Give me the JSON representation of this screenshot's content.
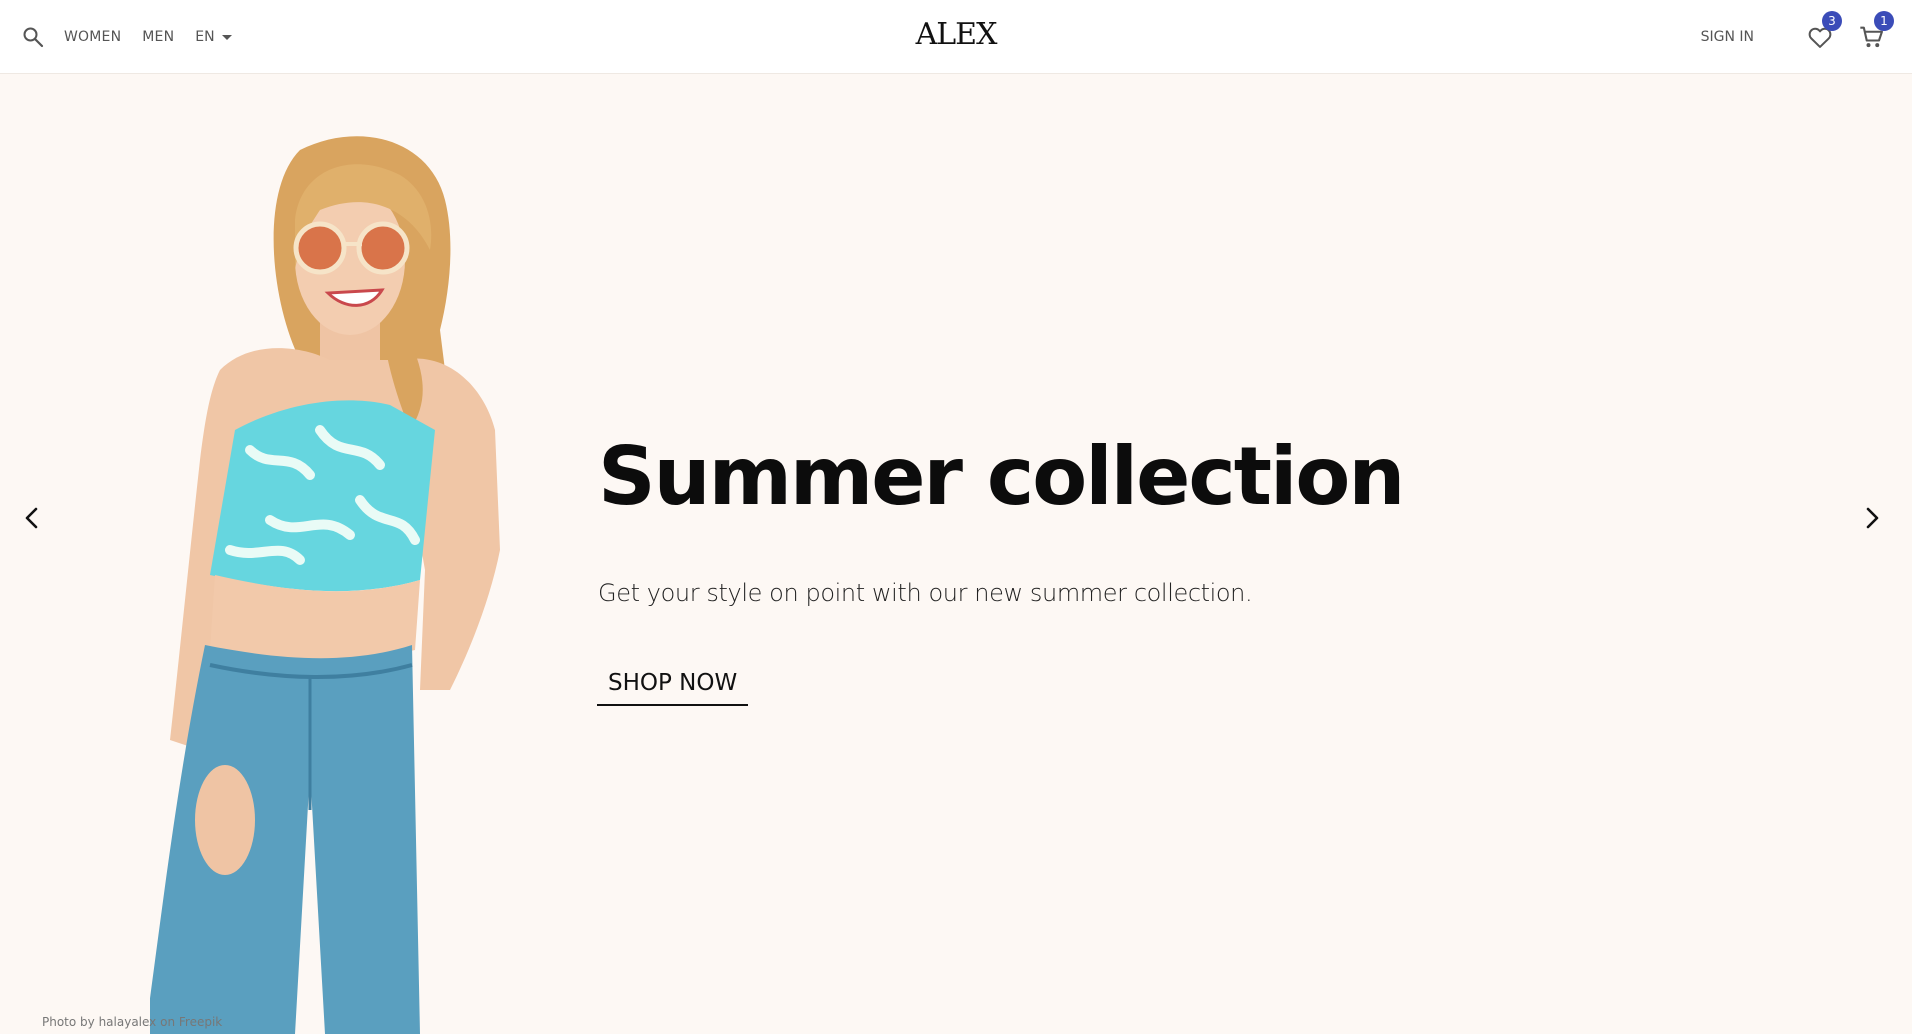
{
  "header": {
    "logo": "ALEX",
    "nav": [
      {
        "label": "WOMEN"
      },
      {
        "label": "MEN"
      }
    ],
    "language": "EN",
    "sign_in": "SIGN IN",
    "wishlist_count": "3",
    "cart_count": "1"
  },
  "hero": {
    "title": "Summer collection",
    "subtitle": "Get your style on point with our new summer collection.",
    "cta": "SHOP NOW",
    "photo_credit": "Photo by halayalex on Freepik"
  },
  "icons": {
    "search": "search-icon",
    "language_dropdown": "caret-down-icon",
    "wishlist": "heart-icon",
    "cart": "cart-icon",
    "prev": "chevron-left-icon",
    "next": "chevron-right-icon"
  },
  "colors": {
    "hero_background": "#fdf8f4",
    "badge": "#3b4cb8",
    "text": "#111111"
  }
}
